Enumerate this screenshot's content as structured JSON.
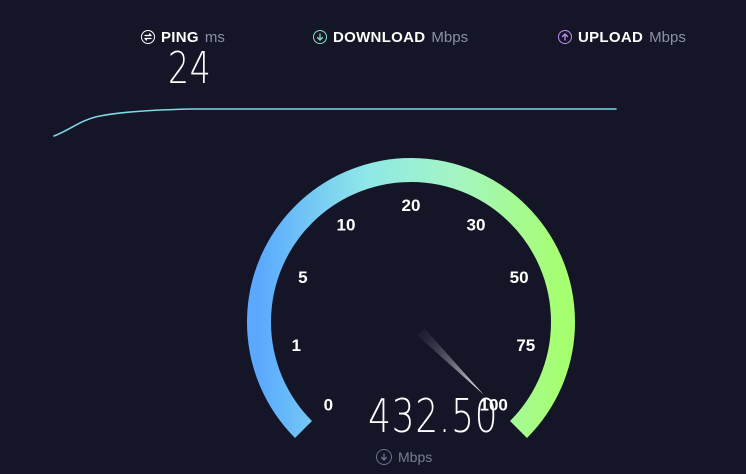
{
  "header": {
    "ping": {
      "label": "PING",
      "unit": "ms",
      "icon": "ping-icon",
      "value": "24",
      "icon_color": "#ffffff"
    },
    "download": {
      "label": "DOWNLOAD",
      "unit": "Mbps",
      "icon": "download-arrow-icon",
      "icon_color": "#7fe0c4"
    },
    "upload": {
      "label": "UPLOAD",
      "unit": "Mbps",
      "icon": "upload-arrow-icon",
      "icon_color": "#c08ff0"
    }
  },
  "gauge": {
    "ticks": [
      "0",
      "1",
      "5",
      "10",
      "20",
      "30",
      "50",
      "75",
      "100"
    ],
    "current_value": "432.50",
    "unit": "Mbps",
    "unit_icon": "download-arrow-icon",
    "needle_position": "100",
    "colors": {
      "start": "#5aa9ff",
      "mid": "#8ff0d6",
      "end": "#a6ff6e"
    }
  },
  "colors": {
    "background": "#141526",
    "line": "#7fd8e6",
    "muted": "#8d8fa6"
  }
}
